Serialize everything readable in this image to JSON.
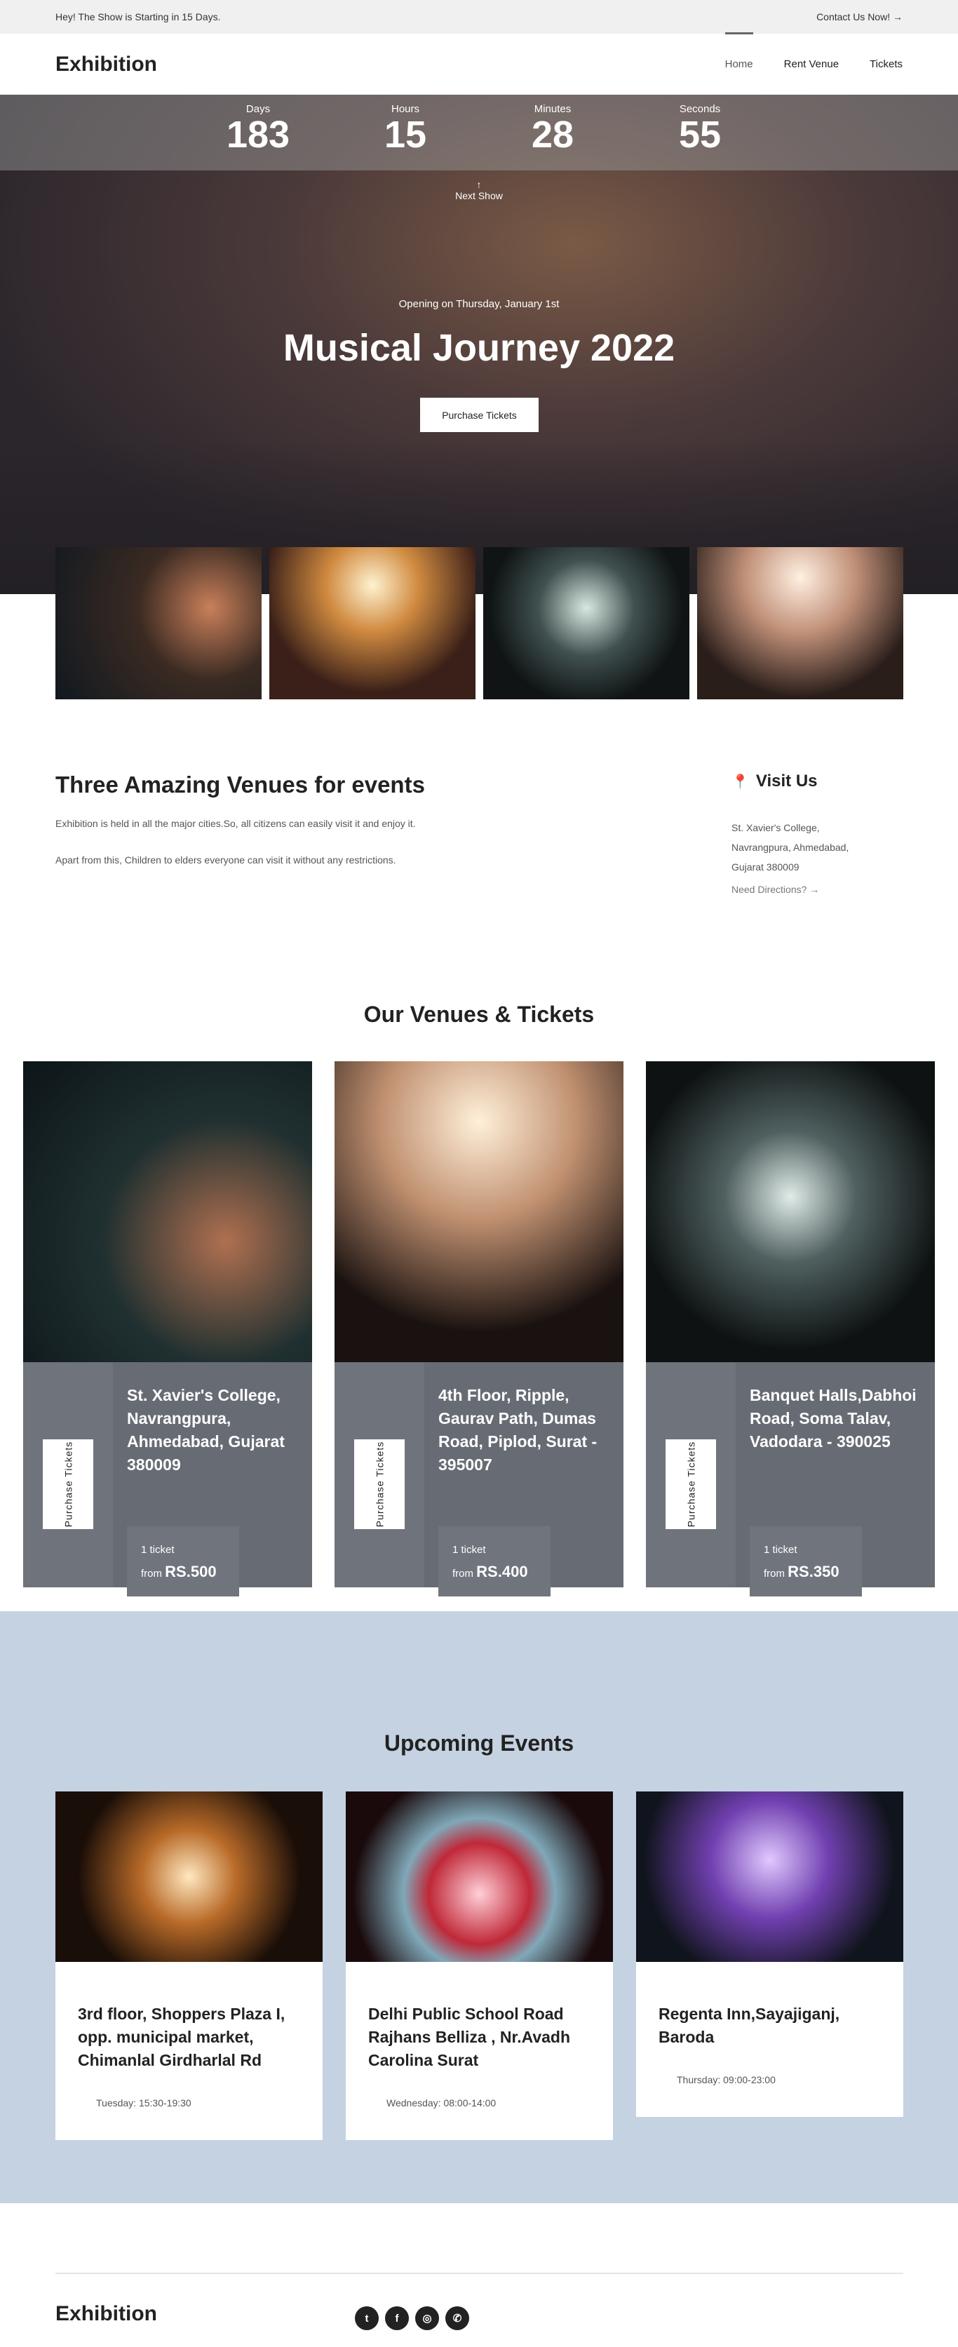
{
  "topbar": {
    "announcement": "Hey! The Show is Starting in 15 Days.",
    "contact": "Contact Us Now!",
    "contact_icon": "arrow-right-icon"
  },
  "nav": {
    "logo": "Exhibition",
    "items": [
      "Home",
      "Rent Venue",
      "Tickets"
    ]
  },
  "countdown": [
    {
      "label": "Days",
      "value": "183"
    },
    {
      "label": "Hours",
      "value": "15"
    },
    {
      "label": "Minutes",
      "value": "28"
    },
    {
      "label": "Seconds",
      "value": "55"
    }
  ],
  "hero": {
    "next": "Next Show",
    "opening": "Opening on Thursday, January 1st",
    "title": "Musical Journey 2022",
    "button": "Purchase Tickets"
  },
  "intro": {
    "title": "Three Amazing Venues for events",
    "p1": "Exhibition is held in all the major cities.So, all citizens can easily visit it and enjoy it.",
    "p2": "Apart from this, Children to elders everyone can visit it without any restrictions.",
    "visit_title": "Visit Us",
    "visit_lines": [
      "St. Xavier's College,",
      "Navrangpura, Ahmedabad,",
      "Gujarat 380009"
    ],
    "directions": "Need Directions?"
  },
  "venues": {
    "title": "Our Venues & Tickets",
    "cards": [
      {
        "button": "Purchase Tickets",
        "address": "St. Xavier's College, Navrangpura, Ahmedabad, Gujarat 380009",
        "ticket": "1 ticket",
        "from": "from",
        "price": "RS.500"
      },
      {
        "button": "Purchase Tickets",
        "address": "4th Floor, Ripple, Gaurav Path, Dumas Road, Piplod, Surat - 395007",
        "ticket": "1 ticket",
        "from": "from",
        "price": "RS.400"
      },
      {
        "button": "Purchase Tickets",
        "address": "Banquet Halls,Dabhoi Road, Soma Talav, Vadodara - 390025",
        "ticket": "1 ticket",
        "from": "from",
        "price": "RS.350"
      }
    ]
  },
  "events": {
    "title": "Upcoming Events",
    "cards": [
      {
        "address": "3rd floor, Shoppers Plaza I, opp. municipal market, Chimanlal Girdharlal Rd",
        "time": "Tuesday: 15:30-19:30"
      },
      {
        "address": "Delhi Public School Road Rajhans Belliza , Nr.Avadh Carolina Surat",
        "time": "Wednesday: 08:00-14:00"
      },
      {
        "address": "Regenta Inn,Sayajiganj, Baroda",
        "time": "Thursday: 09:00-23:00"
      }
    ]
  },
  "footer": {
    "logo": "Exhibition",
    "social": [
      "twitter-icon",
      "facebook-icon",
      "instagram-icon",
      "whatsapp-icon"
    ]
  },
  "colors": {
    "card": "#676c74",
    "blue_section": "#c5d2e2"
  }
}
